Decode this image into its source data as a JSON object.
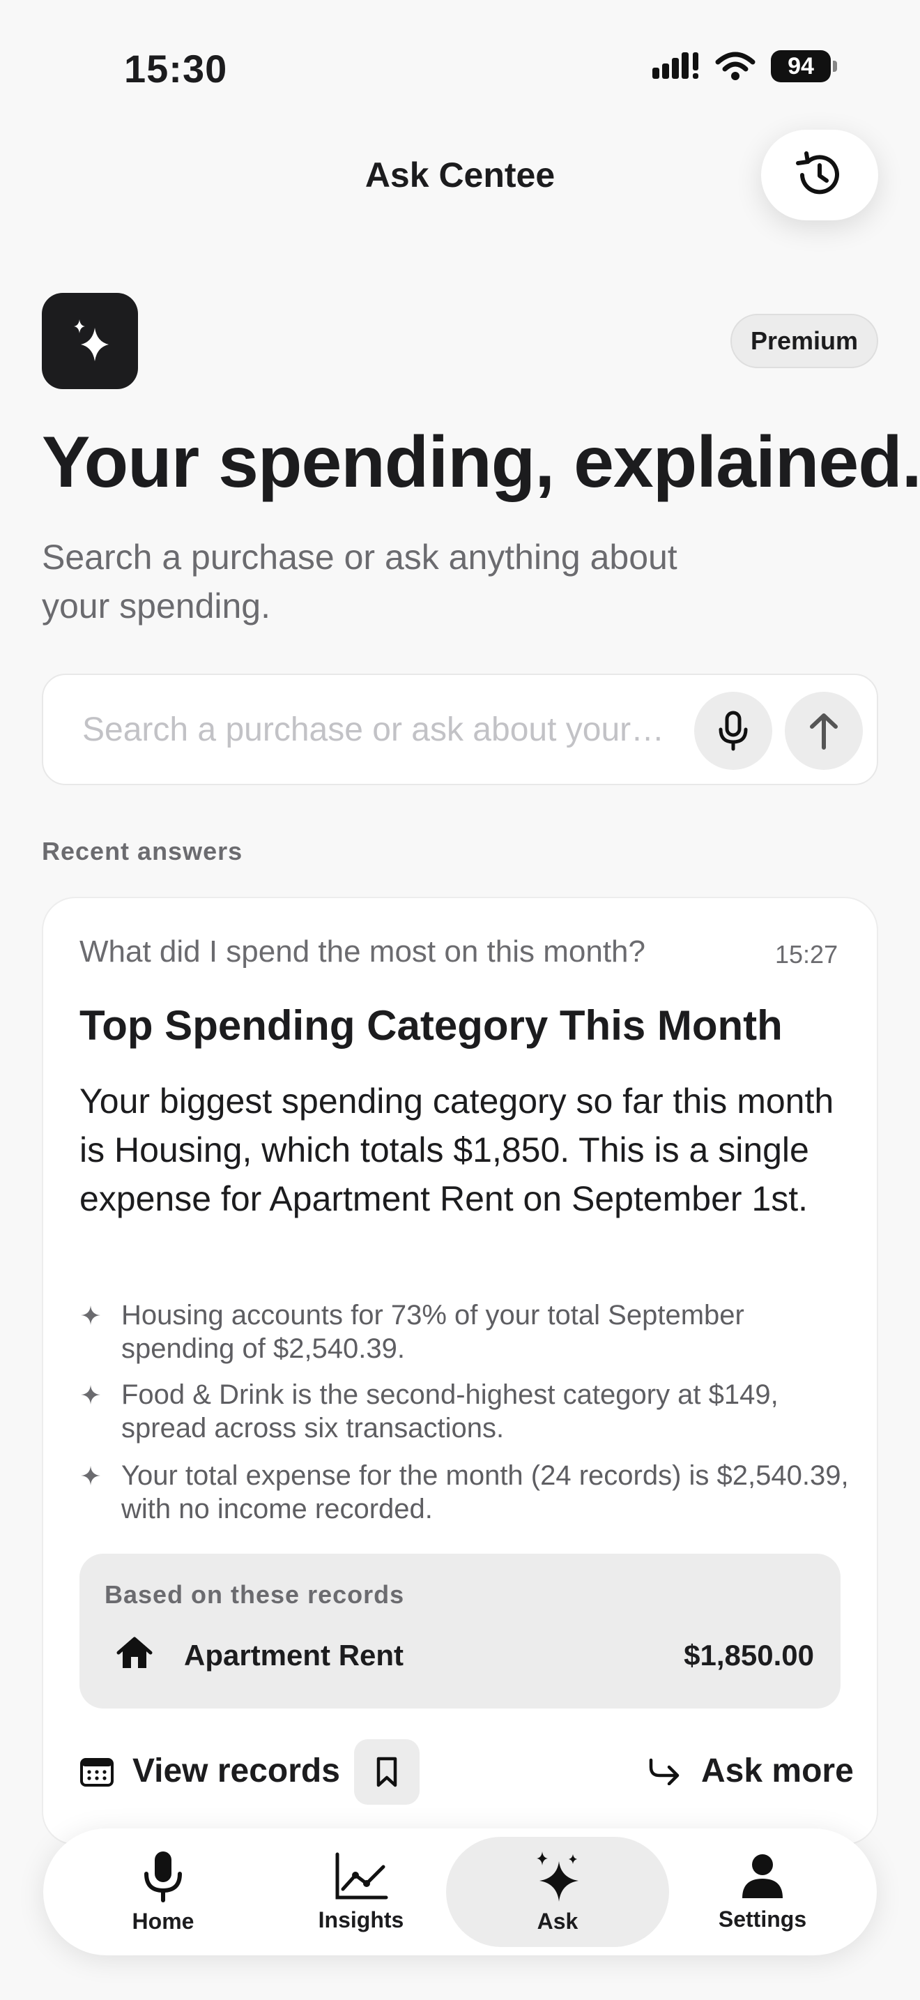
{
  "status_bar": {
    "time": "15:30",
    "battery": "94"
  },
  "header": {
    "title": "Ask Centee"
  },
  "hero": {
    "badge": "Premium",
    "headline": "Your spending, explained.",
    "subtitle": "Search a purchase or ask anything about your spending."
  },
  "search": {
    "placeholder": "Search a purchase or ask about your…"
  },
  "recent": {
    "section_label": "Recent answers",
    "question": "What did I spend the most on this month?",
    "time": "15:27",
    "title": "Top Spending Category This Month",
    "body": "Your biggest spending category so far this month is Housing, which totals $1,850. This is a single expense for Apartment Rent on September 1st.",
    "bullets": [
      "Housing accounts for 73% of your total September spending of $2,540.39.",
      "Food & Drink is the second-highest category at $149, spread across six transactions.",
      "Your total expense for the month (24 records) is $2,540.39, with no income recorded."
    ],
    "records_label": "Based on these records",
    "record": {
      "name": "Apartment Rent",
      "amount": "$1,850.00",
      "icon": "house-icon"
    },
    "view_records": "View records",
    "ask_more": "Ask more"
  },
  "tabbar": {
    "items": [
      {
        "label": "Home",
        "icon": "microphone-icon"
      },
      {
        "label": "Insights",
        "icon": "chart-icon"
      },
      {
        "label": "Ask",
        "icon": "sparkle-icon",
        "active": true
      },
      {
        "label": "Settings",
        "icon": "person-icon"
      }
    ]
  }
}
